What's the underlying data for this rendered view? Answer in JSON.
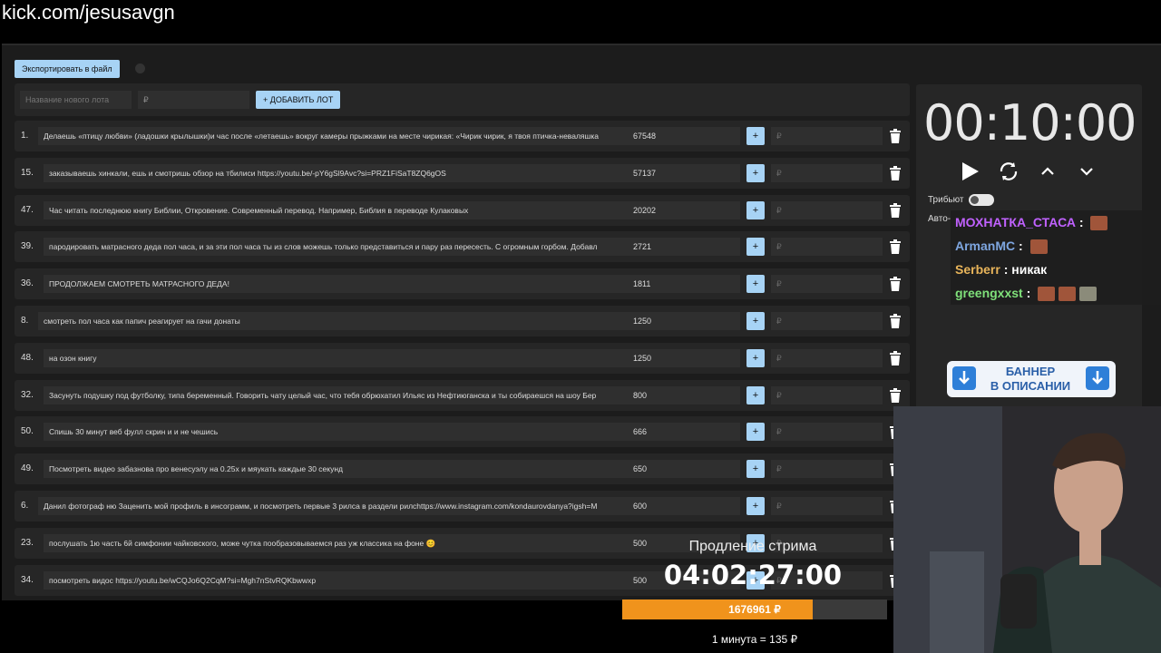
{
  "browser": {
    "url": "kick.com/jesusavgn"
  },
  "toolbar": {
    "export_label": "Экспортировать в файл"
  },
  "new_lot": {
    "name_placeholder": "Название нового лота",
    "price_placeholder": "₽",
    "add_label": "+ ДОБАВИТЬ ЛОТ"
  },
  "lots": [
    {
      "num": "1.",
      "text": "Делаешь «птицу любви» (ладошки крылышки)и час после «летаешь» вокруг камеры прыжками на месте чирикая: «Чирик чирик, я твоя птичка-неваляшка",
      "amount": "67548",
      "plus": "+",
      "rub": "₽"
    },
    {
      "num": "15.",
      "text": "заказываешь хинкали, ешь и смотришь обзор на тбилиси https://youtu.be/-pY6gSl9Avc?si=PRZ1FiSaT8ZQ6gOS",
      "amount": "57137",
      "plus": "+",
      "rub": "₽"
    },
    {
      "num": "47.",
      "text": "Час читать последнюю книгу Библии, Откровение. Современный перевод. Например, Библия в переводе Кулаковых",
      "amount": "20202",
      "plus": "+",
      "rub": "₽"
    },
    {
      "num": "39.",
      "text": "пародировать матрасного деда пол часа, и за эти пол часа ты из слов можешь только представиться и пару раз пересесть. С огромным горбом. Добавл",
      "amount": "2721",
      "plus": "+",
      "rub": "₽"
    },
    {
      "num": "36.",
      "text": "ПРОДОЛЖАЕМ СМОТРЕТЬ МАТРАСНОГО ДЕДА!",
      "amount": "1811",
      "plus": "+",
      "rub": "₽"
    },
    {
      "num": "8.",
      "text": "смотреть пол часа как папич реагирует на гачи донаты",
      "amount": "1250",
      "plus": "+",
      "rub": "₽"
    },
    {
      "num": "48.",
      "text": "на озон книгу",
      "amount": "1250",
      "plus": "+",
      "rub": "₽"
    },
    {
      "num": "32.",
      "text": "Засунуть подушку под футболку, типа беременный. Говорить чату целый час, что тебя обрюхатил Ильяс из Нефтиюганска и ты собираешся на шоу Бер",
      "amount": "800",
      "plus": "+",
      "rub": "₽"
    },
    {
      "num": "50.",
      "text": "Спишь 30 минут веб фулл скрин и и не чешись",
      "amount": "666",
      "plus": "+",
      "rub": "₽"
    },
    {
      "num": "49.",
      "text": "Посмотреть видео забазнова про венесуэлу на 0.25х и мяукать каждые 30 секунд",
      "amount": "650",
      "plus": "+",
      "rub": "₽"
    },
    {
      "num": "6.",
      "text": "Данил фотограф ню Заценить мой профиль в инсограмм, и посмотреть первые 3 рилса в раздели рилсhttps://www.instagram.com/kondaurovdanya?igsh=M",
      "amount": "600",
      "plus": "+",
      "rub": "₽"
    },
    {
      "num": "23.",
      "text": "послушать 1ю часть 6й симфонии чайковского, може чутка пообразовываемся раз уж классика на фоне 😊",
      "amount": "500",
      "plus": "+",
      "rub": "₽"
    },
    {
      "num": "34.",
      "text": "посмотреть видос https://youtu.be/wCQJo6Q2CqM?si=Mgh7nStvRQKbwwxp",
      "amount": "500",
      "plus": "+",
      "rub": "₽"
    }
  ],
  "timer": {
    "display": "00:10:00",
    "tribute_label": "Трибьют",
    "auto_label": "Авто-"
  },
  "chat": [
    {
      "user": "МОХНАТКА_СТАСА",
      "color": "#c061ff",
      "sep": " :",
      "text": "",
      "emotes": 1
    },
    {
      "user": "ArmanMC",
      "color": "#7ea6e0",
      "sep": " :",
      "text": "",
      "emotes": 1
    },
    {
      "user": "Serberr",
      "color": "#e8b45a",
      "sep": " :",
      "text": "никак",
      "emotes": 0
    },
    {
      "user": "greengxxst",
      "color": "#7fe07a",
      "sep": " :",
      "text": "",
      "emotes": 3
    }
  ],
  "banner": {
    "line1": "БАННЕР",
    "line2": "В ОПИСАНИИ"
  },
  "extension": {
    "label": "Продление стрима",
    "time": "04:02:27:00"
  },
  "progress": {
    "value": "1676961 ₽",
    "fraction": 0.72
  },
  "rate": {
    "text": "1 минута = 135 ₽"
  },
  "colors": {
    "accent": "#a7d3f5",
    "progress": "#f0931c",
    "panel": "#262626"
  }
}
